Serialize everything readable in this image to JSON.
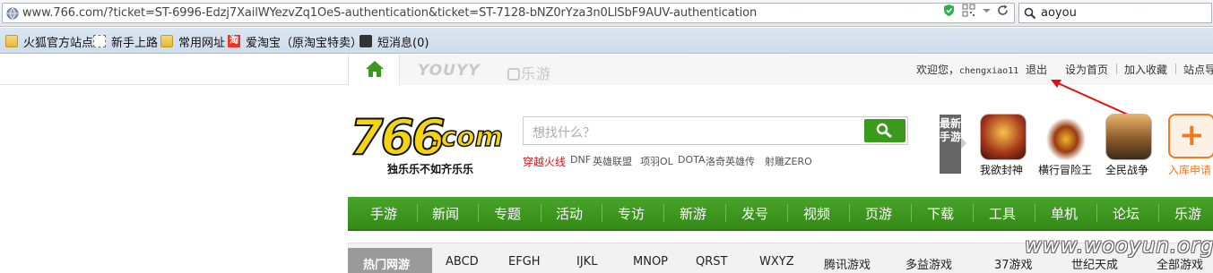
{
  "browser": {
    "url": "www.766.com/?ticket=ST-6996-Edzj7XailWYezvZq1OeS-authentication&ticket=ST-7128-bNZ0rYza3n0LlSbF9AUV-authentication",
    "search_value": "aoyou",
    "bookmarks": [
      {
        "label": "火狐官方站点",
        "icon": "folder-icon"
      },
      {
        "label": "新手上路",
        "icon": "page-icon"
      },
      {
        "label": "常用网址",
        "icon": "folder-icon"
      },
      {
        "label": "爱淘宝（原淘宝特卖）",
        "icon": "taobao-icon"
      },
      {
        "label": "短消息(0)",
        "icon": "message-icon"
      }
    ],
    "taobao_glyph": "淘"
  },
  "site": {
    "brands": [
      "YOUYY",
      "乐游"
    ],
    "welcome": "欢迎您，",
    "username": "chengxiao11",
    "logout": "退出",
    "set_home": "设为首页",
    "add_favorite": "加入收藏",
    "site_nav": "站点导",
    "logo_text": "766",
    "logo_com": ".com",
    "logo_slogan": "独乐乐不如齐乐乐",
    "search_placeholder": "想找什么？",
    "hot_words": [
      {
        "label": "穿越火线",
        "style": "red"
      },
      {
        "label": "DNF",
        "style": "gray"
      },
      {
        "label": "英雄联盟",
        "style": "gray"
      },
      {
        "label": "项羽OL",
        "style": "gray"
      },
      {
        "label": "DOTA",
        "style": "gray"
      },
      {
        "label": "洛奇英雄传",
        "style": "gray"
      },
      {
        "label": "射雕ZERO",
        "style": "gray"
      }
    ],
    "new_games_label": "最新手游",
    "new_games": [
      "我欲封神",
      "横行冒险王",
      "全民战争"
    ],
    "add_label": "入库申请",
    "add_symbol": "+",
    "main_nav": [
      "手游",
      "新闻",
      "专题",
      "活动",
      "专访",
      "新游",
      "发号",
      "视频",
      "页游",
      "下载",
      "工具",
      "单机",
      "论坛",
      "乐游"
    ],
    "categories": [
      "热门网游",
      "ABCD",
      "EFGH",
      "IJKL",
      "MNOP",
      "QRST",
      "WXYZ",
      "腾讯游戏",
      "多益游戏",
      "37游戏",
      "世纪天成",
      "全部游戏"
    ],
    "watermark": "www.wooyun.org"
  },
  "colors": {
    "nav_green": "#3a9a1b",
    "hot_red": "#d4141c",
    "annotation_red": "#e01010",
    "accent_orange": "#f07a1e"
  }
}
